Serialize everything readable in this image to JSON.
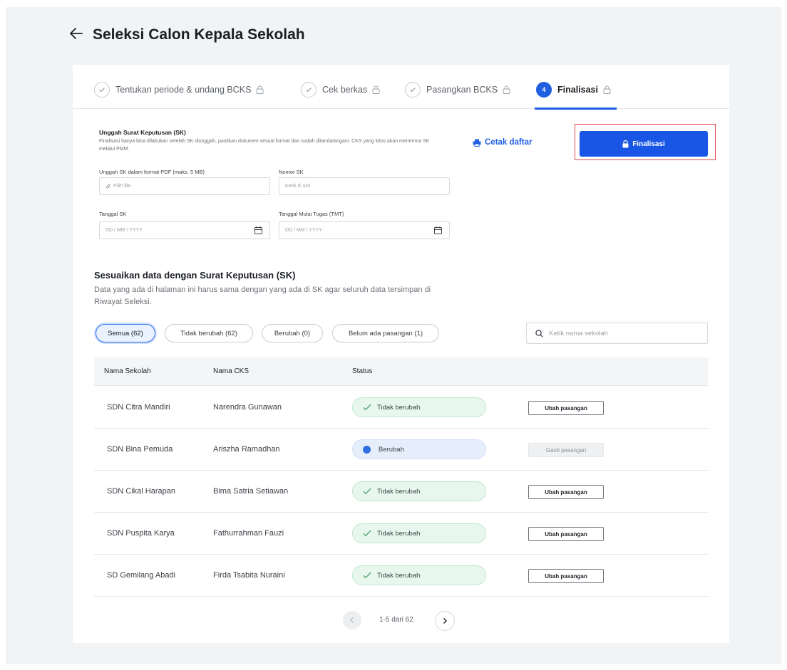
{
  "page": {
    "title": "Seleksi Calon Kepala Sekolah"
  },
  "stepper": {
    "steps": [
      {
        "label": "Tentukan periode & undang BCKS",
        "state": "done"
      },
      {
        "label": "Cek berkas",
        "state": "done"
      },
      {
        "label": "Pasangkan BCKS",
        "state": "done"
      },
      {
        "label": "Finalisasi",
        "state": "active",
        "number": "4"
      }
    ]
  },
  "upload": {
    "title": "Unggah Surat Keputusan (SK)",
    "description": "Finalisasi hanya bisa dilakukan setelah SK diunggah, pastikan dokumen sesuai format dan sudah ditandatangani. CKS yang lolos akan menerima SK melalui PMM.",
    "print_label": "Cetak daftar",
    "finalize_label": "Finalisasi",
    "file_label": "Unggah SK dalam format PDF (maks. 5 MB)",
    "file_placeholder": "Pilih file",
    "number_label": "Nomor SK",
    "number_placeholder": "Ketik di sini",
    "date_label": "Tanggal SK",
    "date_placeholder": "DD / MM / YYYY",
    "tmt_label": "Tanggal Mulai Tugas (TMT)",
    "tmt_placeholder": "DD / MM / YYYY"
  },
  "sync": {
    "title": "Sesuaikan data dengan Surat Keputusan (SK)",
    "description": "Data yang ada di halaman ini harus sama dengan yang ada di SK agar seluruh data tersimpan di Riwayat Seleksi."
  },
  "filters": [
    {
      "label": "Semua (62)",
      "active": true
    },
    {
      "label": "Tidak berubah (62)",
      "active": false
    },
    {
      "label": "Berubah (0)",
      "active": false
    },
    {
      "label": "Belum ada pasangan (1)",
      "active": false
    }
  ],
  "search": {
    "placeholder": "Ketik nama sekolah"
  },
  "table": {
    "headers": [
      "Nama Sekolah",
      "Nama CKS",
      "Status"
    ],
    "rows": [
      {
        "school": "SDN Citra Mandiri",
        "cks": "Narendra Gunawan",
        "status": "Tidak berubah",
        "action": "Ubah pasangan"
      },
      {
        "school": "SDN Bina Pemuda",
        "cks": "Ariszha Ramadhan",
        "status": "Berubah",
        "action": "Ganti pasangan"
      },
      {
        "school": "SDN Cikal Harapan",
        "cks": "Bima Satria Setiawan",
        "status": "Tidak berubah",
        "action": "Ubah pasangan"
      },
      {
        "school": "SDN Puspita Karya",
        "cks": "Fathurrahman Fauzi",
        "status": "Tidak berubah",
        "action": "Ubah pasangan"
      },
      {
        "school": "SD Gemilang Abadi",
        "cks": "Firda Tsabita Nuraini",
        "status": "Tidak berubah",
        "action": "Ubah pasangan"
      }
    ]
  },
  "pagination": {
    "label": "1-5 dari 62"
  },
  "colors": {
    "primary": "#1a56e6",
    "highlight": "#e5484d",
    "status_same_bg": "#e8f7ee",
    "status_changed_bg": "#e5eefb"
  }
}
